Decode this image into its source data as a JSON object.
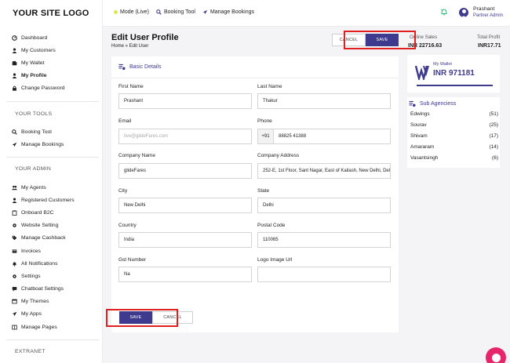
{
  "sidebar": {
    "logo": "YOUR SITE LOGO",
    "main_items": [
      {
        "label": "Dashboard",
        "icon": "dashboard-icon"
      },
      {
        "label": "My Customers",
        "icon": "user-icon"
      },
      {
        "label": "My Wallet",
        "icon": "wallet-icon"
      },
      {
        "label": "My Profile",
        "icon": "profile-icon",
        "active": true
      },
      {
        "label": "Change Password",
        "icon": "lock-icon"
      }
    ],
    "tools_title": "YOUR TOOLS",
    "tools_items": [
      {
        "label": "Booking Tool",
        "icon": "search-icon"
      },
      {
        "label": "Manage Bookings",
        "icon": "plane-icon"
      }
    ],
    "admin_title": "YOUR ADMIN",
    "admin_items": [
      {
        "label": "My Agents",
        "icon": "users-icon"
      },
      {
        "label": "Registered Customers",
        "icon": "user-icon"
      },
      {
        "label": "Onboard B2C",
        "icon": "clipboard-icon"
      },
      {
        "label": "Website Setting",
        "icon": "gear-icon"
      },
      {
        "label": "Manage Cashback",
        "icon": "tag-icon"
      },
      {
        "label": "Invoices",
        "icon": "invoice-icon"
      },
      {
        "label": "All Notifications",
        "icon": "bell-icon"
      },
      {
        "label": "Settings",
        "icon": "gear-icon"
      },
      {
        "label": "Chatboat Settings",
        "icon": "chat-icon"
      },
      {
        "label": "My Themes",
        "icon": "theme-icon"
      },
      {
        "label": "My Apps",
        "icon": "send-icon"
      },
      {
        "label": "Manage Pages",
        "icon": "pages-icon"
      }
    ],
    "extranet_title": "EXTRANET"
  },
  "topbar": {
    "mode": "Mode (Live)",
    "booking_tool": "Booking Tool",
    "manage_bookings": "Manage Bookings",
    "user_name": "Prashant",
    "user_role": "Partner Admin"
  },
  "page": {
    "title": "Edit User Profile",
    "breadcrumb": "Home » Edit User",
    "cancel_label": "CANCEL",
    "save_label": "SAVE"
  },
  "stats": {
    "online_sales_label": "Online Sales",
    "online_sales_value": "INR 22716.63",
    "total_profit_label": "Total Profit",
    "total_profit_value": "INR17.71"
  },
  "form": {
    "section_title": "Basic Details",
    "first_name_label": "First Name",
    "first_name": "Prashant",
    "last_name_label": "Last Name",
    "last_name": "Thakur",
    "email_label": "Email",
    "email_placeholder": "live@glideFares.com",
    "phone_label": "Phone",
    "phone_prefix": "+91",
    "phone": "88825 41388",
    "company_name_label": "Company Name",
    "company_name": "glideFares",
    "company_address_label": "Company Address",
    "company_address": "252-E, 1st Floor, Sant Nagar, East of Kailash, New Delhi, Delhi",
    "city_label": "City",
    "city": "New Delhi",
    "state_label": "State",
    "state": "Delhi",
    "country_label": "Country",
    "country": "India",
    "postal_code_label": "Postal Code",
    "postal_code": "110065",
    "gst_label": "Gst Number",
    "gst": "Na",
    "logo_label": "Logo Image Url",
    "logo_url": ""
  },
  "wallet": {
    "label": "My Wallet",
    "value": "INR 971181"
  },
  "sub_agencies": {
    "title": "Sub Agenciess",
    "items": [
      {
        "name": "Edwings",
        "count": "(51)"
      },
      {
        "name": "Sourav",
        "count": "(25)"
      },
      {
        "name": "Shivam",
        "count": "(17)"
      },
      {
        "name": "Amararam",
        "count": "(14)"
      },
      {
        "name": "Vasantsingh",
        "count": "(6)"
      }
    ]
  },
  "colors": {
    "primary": "#3e3b8f",
    "highlight": "#e01f1f",
    "chat": "#e6256b",
    "mode_dot": "#e3e64b"
  }
}
